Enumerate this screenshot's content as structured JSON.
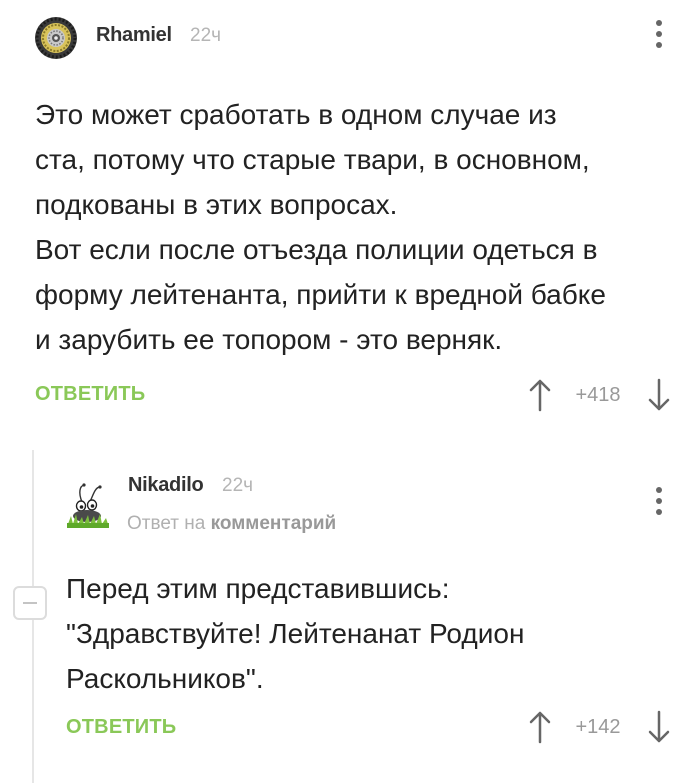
{
  "comments": [
    {
      "author": "Rhamiel",
      "time": "22ч",
      "avatar_icon": "bicycle-cassette-avatar-icon",
      "text_lines": [
        "Это может сработать в одном случае из",
        "ста,  потому что старые твари, в основном,",
        "подкованы в этих вопросах.",
        "Вот если после отъезда полиции одеться в",
        "форму лейтенанта, прийти к вредной бабке",
        "и зарубить ее топором - это верняк."
      ],
      "reply_label": "ОТВЕТИТЬ",
      "score": "+418"
    },
    {
      "author": "Nikadilo",
      "time": "22ч",
      "avatar_icon": "insect-on-grass-avatar-icon",
      "reply_to_prefix": "Ответ на",
      "reply_to_link": "комментарий",
      "text_lines": [
        "Перед этим представившись:",
        "\"Здравствуйте! Лейтенанат Родион",
        "Раскольников\"."
      ],
      "reply_label": "ОТВЕТИТЬ",
      "score": "+142"
    }
  ],
  "icons": {
    "upvote": "arrow-up-icon",
    "downvote": "arrow-down-icon",
    "menu": "kebab-menu-icon",
    "collapse": "minus-icon"
  },
  "colors": {
    "reply_green": "#8ac858",
    "score_gray": "#999999",
    "time_gray": "#b5b5b5",
    "text_dark": "#222222"
  }
}
